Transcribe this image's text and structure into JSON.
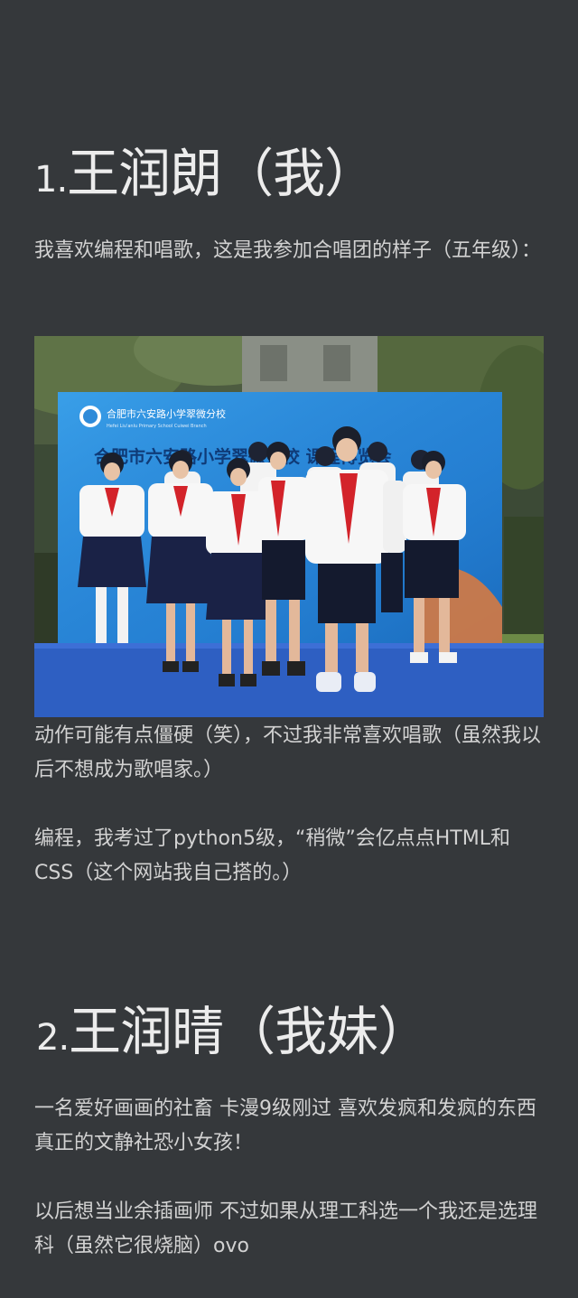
{
  "section1": {
    "title_number": "1.",
    "title_text": "王润朗（我）",
    "intro": "我喜欢编程和唱歌，这是我参加合唱团的样子（五年级）：",
    "photo": {
      "banner_school": "合肥市六安路小学翠微分校",
      "banner_school_en": "Hefei Liu'anlu Primary School Cuiwei Branch",
      "banner_headline": "合肥市六安路小学翠微分校    课程博览会"
    },
    "after_photo": "动作可能有点僵硬（笑），不过我非常喜欢唱歌（虽然我以后不想成为歌唱家。）",
    "coding": "编程，我考过了python5级，“稍微”会亿点点HTML和CSS（这个网站我自己搭的。）"
  },
  "section2": {
    "title_number": "2.",
    "title_text": "王润晴（我妹）",
    "para1": "一名爱好画画的社畜 卡漫9级刚过 喜欢发疯和发疯的东西 真正的文静社恐小女孩！",
    "para2": "以后想当业余插画师 不过如果从理工科选一个我还是选理科（虽然它很烧脑）ovo"
  },
  "colors": {
    "background": "#35383b",
    "heading": "#ececec",
    "text": "#d2d2d2"
  }
}
